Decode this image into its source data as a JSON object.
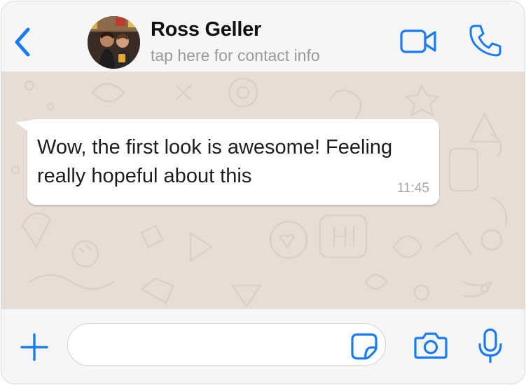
{
  "header": {
    "contact_name": "Ross Geller",
    "subtitle": "tap here for contact info",
    "back_icon": "chevron-left-icon",
    "video_icon": "video-camera-icon",
    "call_icon": "phone-icon"
  },
  "chat": {
    "messages": [
      {
        "direction": "incoming",
        "text": "Wow, the first look is awesome! Feeling really hopeful about this",
        "time": "11:45"
      }
    ]
  },
  "composer": {
    "input_value": "",
    "plus_icon": "plus-icon",
    "sticker_icon": "sticker-icon",
    "camera_icon": "camera-icon",
    "mic_icon": "microphone-icon"
  },
  "colors": {
    "accent": "#1a7cf5",
    "chat_background": "#e6ded6",
    "bar_background": "#f6f6f6",
    "bubble": "#ffffff"
  }
}
